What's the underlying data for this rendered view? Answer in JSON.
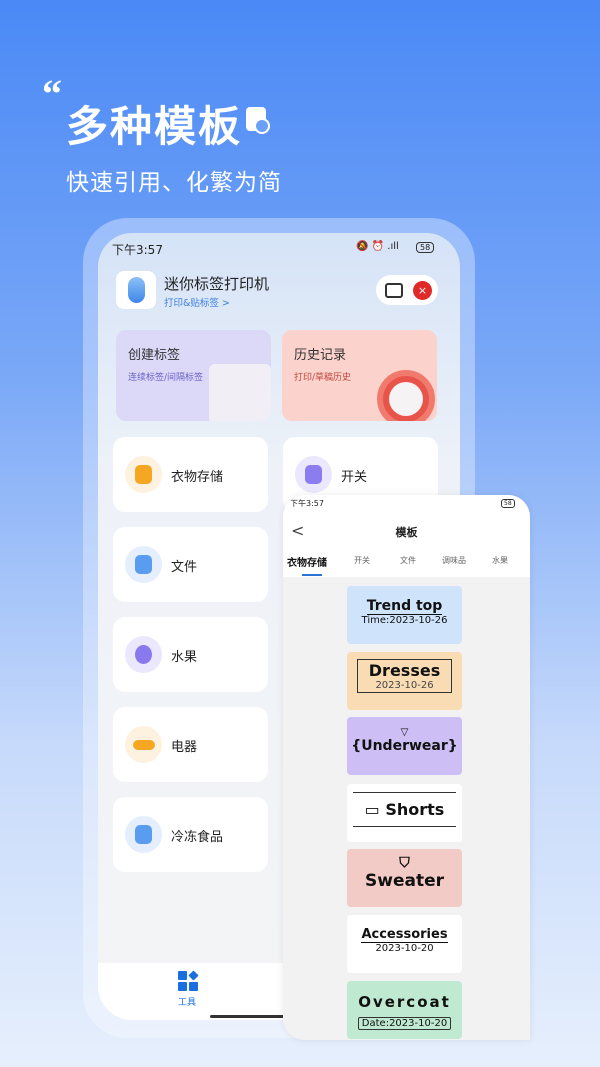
{
  "hero": {
    "quote": "“",
    "title": "多种模板",
    "subtitle": "快速引用、化繁为简"
  },
  "main_phone": {
    "status": {
      "time": "下午3:57",
      "icons": "🔕 ⏰ .ıll",
      "battery": "58"
    },
    "app": {
      "name": "迷你标签打印机",
      "link": "打印&贴标签 >",
      "close": "×"
    },
    "create": {
      "title": "创建标签",
      "sub": "连续标签/间隔标签"
    },
    "history": {
      "title": "历史记录",
      "sub": "打印/草稿历史"
    },
    "categories": [
      {
        "label": "衣物存储",
        "color": "#f5a623"
      },
      {
        "label": "开关",
        "color": "#8b7cf0"
      },
      {
        "label": "文件",
        "color": "#5a9cf0"
      },
      {
        "label": "水果",
        "color": "#8a78ee"
      },
      {
        "label": "电器",
        "color": "#f5a623"
      },
      {
        "label": "冷冻食品",
        "color": "#5a9cf0"
      }
    ],
    "tabbar": {
      "tool": "工具"
    }
  },
  "template_phone": {
    "status": {
      "time": "下午3:57",
      "battery": "58"
    },
    "back": "<",
    "title": "模板",
    "tabs": [
      "衣物存储",
      "开关",
      "文件",
      "调味品",
      "水果"
    ],
    "templates": [
      {
        "title": "Trend top",
        "date": "Time:2023-10-26",
        "bg": "#cfe3fb"
      },
      {
        "title": "Dresses",
        "date": "2023-10-26",
        "bg": "#f9dcb4"
      },
      {
        "title": "Underwear",
        "date": "",
        "bg": "#cdbff5"
      },
      {
        "title": "Shorts",
        "date": "",
        "bg": "#ffffff"
      },
      {
        "title": "Sweater",
        "date": "",
        "bg": "#f2cac6"
      },
      {
        "title": "Accessories",
        "date": "2023-10-20",
        "bg": "#ffffff"
      },
      {
        "title": "Overcoat",
        "date": "Date:2023-10-20",
        "bg": "#bfe9d0"
      }
    ]
  }
}
